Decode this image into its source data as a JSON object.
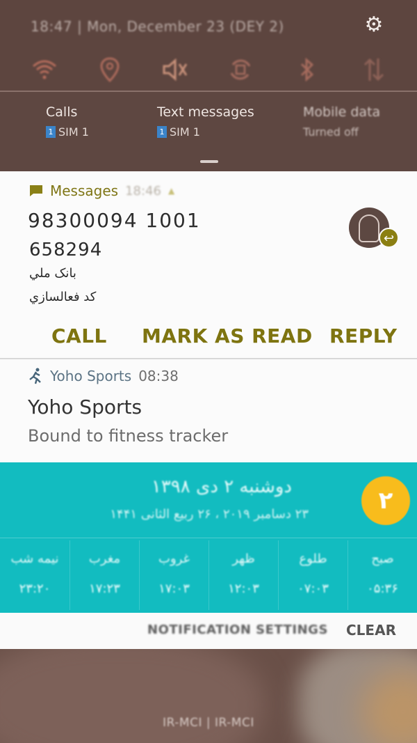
{
  "status_bar": {
    "time": "18:47",
    "date_text": "Mon, December 23 (DEY 2)"
  },
  "quick_settings": {
    "toggles": [
      {
        "name": "wifi-icon",
        "glyph": "◠",
        "color": "#b96d5c"
      },
      {
        "name": "location-icon",
        "glyph": "⌾",
        "color": "#ae6b5c"
      },
      {
        "name": "mute-icon",
        "glyph": "🔇",
        "color": "#c79079"
      },
      {
        "name": "auto-rotate-icon",
        "glyph": "↻",
        "color": "#a36b5e"
      },
      {
        "name": "bluetooth-icon",
        "glyph": "✱",
        "color": "#a56b5d"
      },
      {
        "name": "mobile-data-icon",
        "glyph": "⇅",
        "color": "#8f6258"
      }
    ],
    "sim": {
      "calls_label": "Calls",
      "calls_sim": "SIM 1",
      "text_label": "Text messages",
      "text_sim": "SIM 1",
      "data_label": "Mobile data",
      "data_status": "Turned off",
      "sim_number": "1"
    }
  },
  "messages_notification": {
    "app_name": "Messages",
    "time": "18:46",
    "sender": "98300094 1001",
    "lines": [
      "658294",
      "بانک ملي",
      "کد فعالسازي"
    ],
    "actions": {
      "call": "CALL",
      "mark_read": "MARK AS READ",
      "reply": "REPLY"
    }
  },
  "yoho_notification": {
    "app_name": "Yoho Sports",
    "time": "08:38",
    "title": "Yoho Sports",
    "text": "Bound to fitness tracker"
  },
  "prayer_widget": {
    "day_number": "۲",
    "date_persian": "دوشنبه ۲ دی ۱۳۹۸",
    "date_other": "۲۳ دسامبر ۲۰۱۹ ، ۲۶ ربیع الثانی ۱۴۴۱",
    "times": [
      {
        "name": "نیمه شب",
        "value": "۲۳:۲۰"
      },
      {
        "name": "مغرب",
        "value": "۱۷:۲۳"
      },
      {
        "name": "غروب",
        "value": "۱۷:۰۳"
      },
      {
        "name": "ظهر",
        "value": "۱۲:۰۳"
      },
      {
        "name": "طلوع",
        "value": "۰۷:۰۳"
      },
      {
        "name": "صبح",
        "value": "۰۵:۳۶"
      }
    ]
  },
  "bottom_bar": {
    "settings_label": "NOTIFICATION SETTINGS",
    "clear_label": "CLEAR"
  },
  "wallpaper": {
    "carrier_text": "IR-MCI | IR-MCI"
  }
}
